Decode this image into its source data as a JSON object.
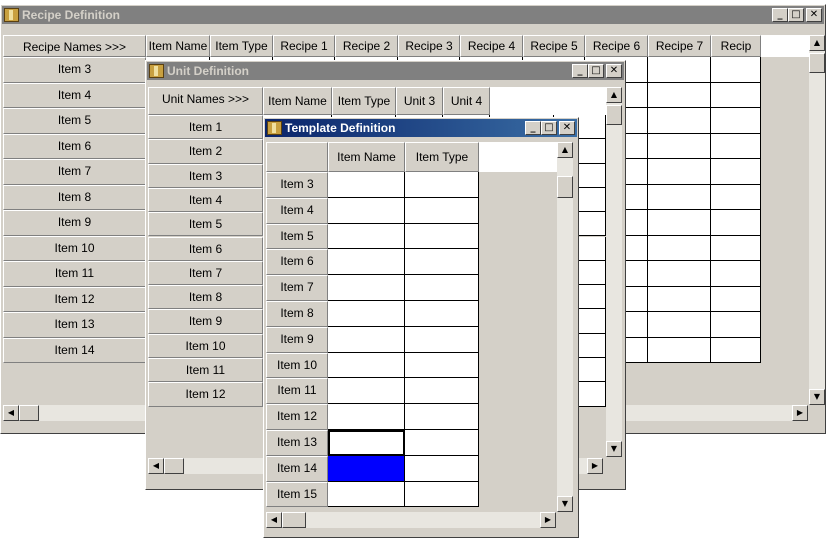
{
  "recipe_window": {
    "title": "Recipe Definition",
    "corner_label": "Recipe Names >>>",
    "columns": [
      "Item Name",
      "Item Type",
      "Recipe 1",
      "Recipe 2",
      "Recipe 3",
      "Recipe 4",
      "Recipe 5",
      "Recipe 6",
      "Recipe 7",
      "Recip"
    ],
    "rows": [
      "Item 3",
      "Item 4",
      "Item 5",
      "Item 6",
      "Item 7",
      "Item 8",
      "Item 9",
      "Item 10",
      "Item 11",
      "Item 12",
      "Item 13",
      "Item 14"
    ]
  },
  "unit_window": {
    "title": "Unit Definition",
    "corner_label": "Unit Names >>>",
    "columns": [
      "Item Name",
      "Item Type",
      "Unit 3",
      "Unit 4"
    ],
    "rows": [
      "Item 1",
      "Item 2",
      "Item 3",
      "Item 4",
      "Item 5",
      "Item 6",
      "Item 7",
      "Item 8",
      "Item 9",
      "Item 10",
      "Item 11",
      "Item 12"
    ]
  },
  "template_window": {
    "title": "Template Definition",
    "columns": [
      "Item Name",
      "Item Type"
    ],
    "rows": [
      "Item 3",
      "Item 4",
      "Item 5",
      "Item 6",
      "Item 7",
      "Item 8",
      "Item 9",
      "Item 10",
      "Item 11",
      "Item 12",
      "Item 13",
      "Item 14",
      "Item 15"
    ]
  },
  "window_buttons": {
    "minimize": "_",
    "maximize": "□",
    "close": "✕"
  },
  "scroll_arrows": {
    "up": "▲",
    "down": "▼",
    "left": "◀",
    "right": "▶"
  },
  "colors": {
    "active_title": "#0a246a",
    "inactive_title": "#808080",
    "selection": "#0000ff"
  }
}
